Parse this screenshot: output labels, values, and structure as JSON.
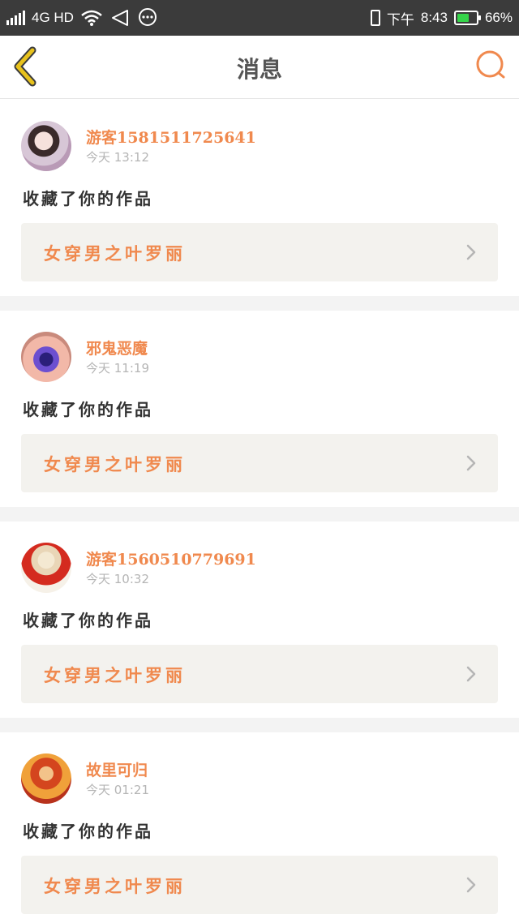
{
  "status_bar": {
    "network": "4G HD",
    "carrier": "下午",
    "time": "8:43",
    "battery_percent": "66%",
    "battery_level": 0.66,
    "battery_color": "#35d54a"
  },
  "header": {
    "title": "消息",
    "back_icon": "chevron-left-icon",
    "search_icon": "search-icon"
  },
  "colors": {
    "accent": "#f0894e",
    "back_icon": "#e8c21c",
    "card_link_bg": "#f3f2ee"
  },
  "messages": [
    {
      "username": "游客1581511725641",
      "time": "今天 13:12",
      "action": "收藏了你的作品",
      "work_title": "女穿男之叶罗丽",
      "avatar": "user-avatar"
    },
    {
      "username": "邪鬼恶魔",
      "time": "今天 11:19",
      "action": "收藏了你的作品",
      "work_title": "女穿男之叶罗丽",
      "avatar": "user-avatar"
    },
    {
      "username": "游客1560510779691",
      "time": "今天 10:32",
      "action": "收藏了你的作品",
      "work_title": "女穿男之叶罗丽",
      "avatar": "user-avatar"
    },
    {
      "username": "故里可归",
      "time": "今天 01:21",
      "action": "收藏了你的作品",
      "work_title": "女穿男之叶罗丽",
      "avatar": "user-avatar"
    }
  ]
}
